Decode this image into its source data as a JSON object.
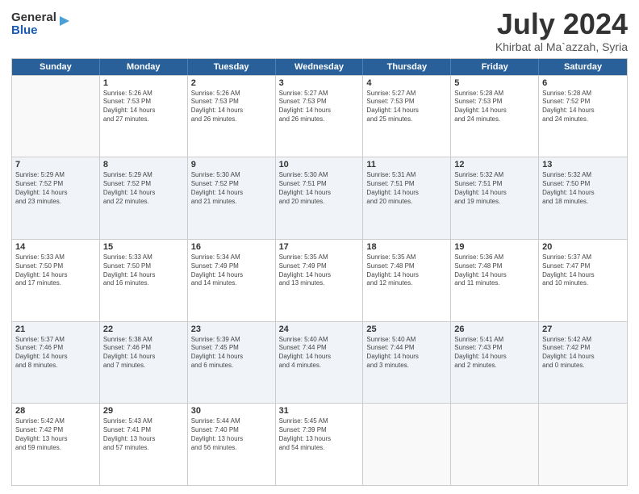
{
  "header": {
    "logo_general": "General",
    "logo_blue": "Blue",
    "month": "July 2024",
    "location": "Khirbat al Ma`azzah, Syria"
  },
  "weekdays": [
    "Sunday",
    "Monday",
    "Tuesday",
    "Wednesday",
    "Thursday",
    "Friday",
    "Saturday"
  ],
  "rows": [
    [
      {
        "day": "",
        "text": "",
        "empty": true
      },
      {
        "day": "1",
        "text": "Sunrise: 5:26 AM\nSunset: 7:53 PM\nDaylight: 14 hours\nand 27 minutes."
      },
      {
        "day": "2",
        "text": "Sunrise: 5:26 AM\nSunset: 7:53 PM\nDaylight: 14 hours\nand 26 minutes."
      },
      {
        "day": "3",
        "text": "Sunrise: 5:27 AM\nSunset: 7:53 PM\nDaylight: 14 hours\nand 26 minutes."
      },
      {
        "day": "4",
        "text": "Sunrise: 5:27 AM\nSunset: 7:53 PM\nDaylight: 14 hours\nand 25 minutes."
      },
      {
        "day": "5",
        "text": "Sunrise: 5:28 AM\nSunset: 7:53 PM\nDaylight: 14 hours\nand 24 minutes."
      },
      {
        "day": "6",
        "text": "Sunrise: 5:28 AM\nSunset: 7:52 PM\nDaylight: 14 hours\nand 24 minutes."
      }
    ],
    [
      {
        "day": "7",
        "text": "Sunrise: 5:29 AM\nSunset: 7:52 PM\nDaylight: 14 hours\nand 23 minutes."
      },
      {
        "day": "8",
        "text": "Sunrise: 5:29 AM\nSunset: 7:52 PM\nDaylight: 14 hours\nand 22 minutes."
      },
      {
        "day": "9",
        "text": "Sunrise: 5:30 AM\nSunset: 7:52 PM\nDaylight: 14 hours\nand 21 minutes."
      },
      {
        "day": "10",
        "text": "Sunrise: 5:30 AM\nSunset: 7:51 PM\nDaylight: 14 hours\nand 20 minutes."
      },
      {
        "day": "11",
        "text": "Sunrise: 5:31 AM\nSunset: 7:51 PM\nDaylight: 14 hours\nand 20 minutes."
      },
      {
        "day": "12",
        "text": "Sunrise: 5:32 AM\nSunset: 7:51 PM\nDaylight: 14 hours\nand 19 minutes."
      },
      {
        "day": "13",
        "text": "Sunrise: 5:32 AM\nSunset: 7:50 PM\nDaylight: 14 hours\nand 18 minutes."
      }
    ],
    [
      {
        "day": "14",
        "text": "Sunrise: 5:33 AM\nSunset: 7:50 PM\nDaylight: 14 hours\nand 17 minutes."
      },
      {
        "day": "15",
        "text": "Sunrise: 5:33 AM\nSunset: 7:50 PM\nDaylight: 14 hours\nand 16 minutes."
      },
      {
        "day": "16",
        "text": "Sunrise: 5:34 AM\nSunset: 7:49 PM\nDaylight: 14 hours\nand 14 minutes."
      },
      {
        "day": "17",
        "text": "Sunrise: 5:35 AM\nSunset: 7:49 PM\nDaylight: 14 hours\nand 13 minutes."
      },
      {
        "day": "18",
        "text": "Sunrise: 5:35 AM\nSunset: 7:48 PM\nDaylight: 14 hours\nand 12 minutes."
      },
      {
        "day": "19",
        "text": "Sunrise: 5:36 AM\nSunset: 7:48 PM\nDaylight: 14 hours\nand 11 minutes."
      },
      {
        "day": "20",
        "text": "Sunrise: 5:37 AM\nSunset: 7:47 PM\nDaylight: 14 hours\nand 10 minutes."
      }
    ],
    [
      {
        "day": "21",
        "text": "Sunrise: 5:37 AM\nSunset: 7:46 PM\nDaylight: 14 hours\nand 8 minutes."
      },
      {
        "day": "22",
        "text": "Sunrise: 5:38 AM\nSunset: 7:46 PM\nDaylight: 14 hours\nand 7 minutes."
      },
      {
        "day": "23",
        "text": "Sunrise: 5:39 AM\nSunset: 7:45 PM\nDaylight: 14 hours\nand 6 minutes."
      },
      {
        "day": "24",
        "text": "Sunrise: 5:40 AM\nSunset: 7:44 PM\nDaylight: 14 hours\nand 4 minutes."
      },
      {
        "day": "25",
        "text": "Sunrise: 5:40 AM\nSunset: 7:44 PM\nDaylight: 14 hours\nand 3 minutes."
      },
      {
        "day": "26",
        "text": "Sunrise: 5:41 AM\nSunset: 7:43 PM\nDaylight: 14 hours\nand 2 minutes."
      },
      {
        "day": "27",
        "text": "Sunrise: 5:42 AM\nSunset: 7:42 PM\nDaylight: 14 hours\nand 0 minutes."
      }
    ],
    [
      {
        "day": "28",
        "text": "Sunrise: 5:42 AM\nSunset: 7:42 PM\nDaylight: 13 hours\nand 59 minutes."
      },
      {
        "day": "29",
        "text": "Sunrise: 5:43 AM\nSunset: 7:41 PM\nDaylight: 13 hours\nand 57 minutes."
      },
      {
        "day": "30",
        "text": "Sunrise: 5:44 AM\nSunset: 7:40 PM\nDaylight: 13 hours\nand 56 minutes."
      },
      {
        "day": "31",
        "text": "Sunrise: 5:45 AM\nSunset: 7:39 PM\nDaylight: 13 hours\nand 54 minutes."
      },
      {
        "day": "",
        "text": "",
        "empty": true
      },
      {
        "day": "",
        "text": "",
        "empty": true
      },
      {
        "day": "",
        "text": "",
        "empty": true
      }
    ]
  ]
}
